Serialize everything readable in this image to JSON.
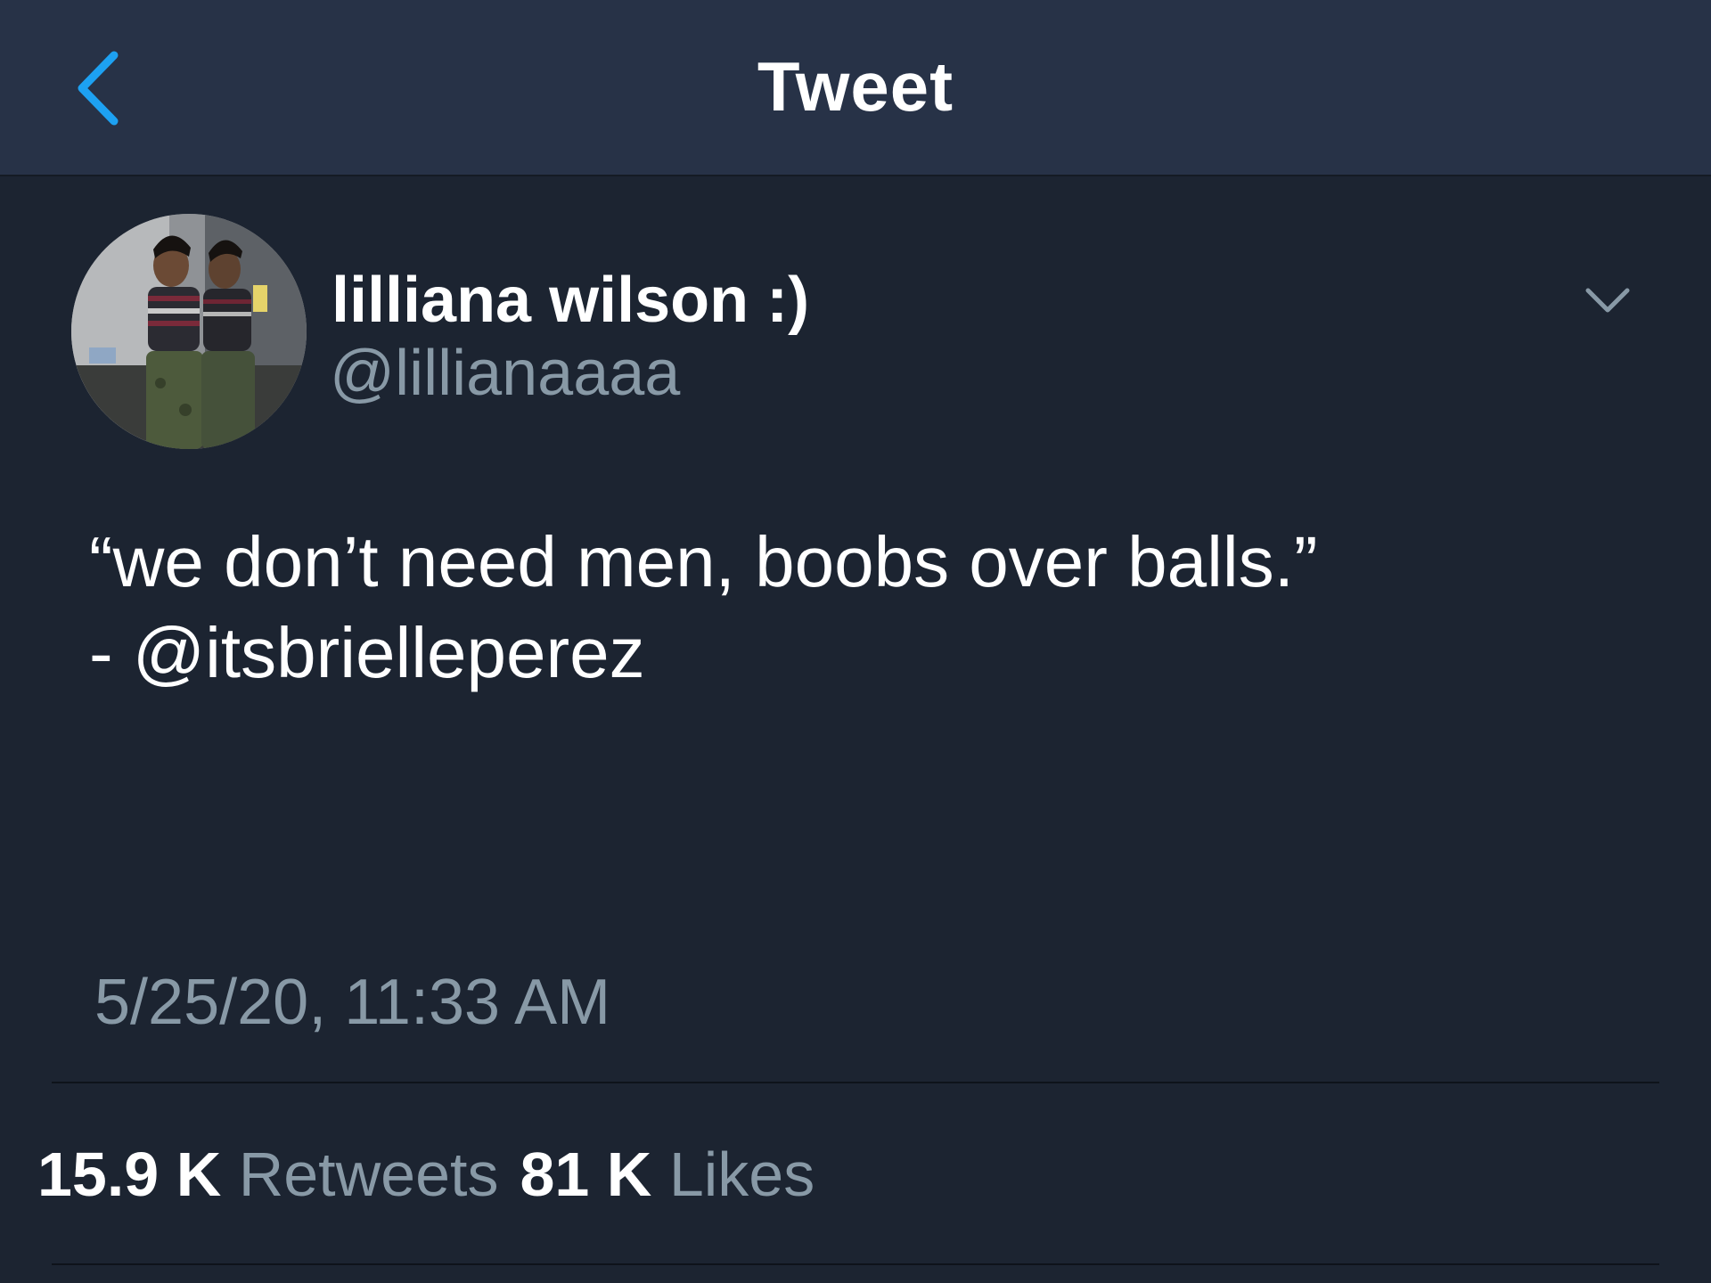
{
  "header": {
    "title": "Tweet",
    "back_icon": "chevron-left-icon"
  },
  "colors": {
    "accent": "#1da1f2",
    "background": "#1c2431",
    "header_bg": "#273247",
    "secondary_text": "#8899a6"
  },
  "tweet": {
    "author": {
      "display_name": "lilliana wilson :)",
      "handle": "@lillianaaaa"
    },
    "menu_icon": "chevron-down-icon",
    "text": "“we don’t need men, boobs over balls.”\n- @itsbrielleperez",
    "timestamp": "5/25/20, 11:33 AM",
    "stats": {
      "retweets_count": "15.9 K",
      "retweets_label": "Retweets",
      "likes_count": "81 K",
      "likes_label": "Likes"
    }
  }
}
